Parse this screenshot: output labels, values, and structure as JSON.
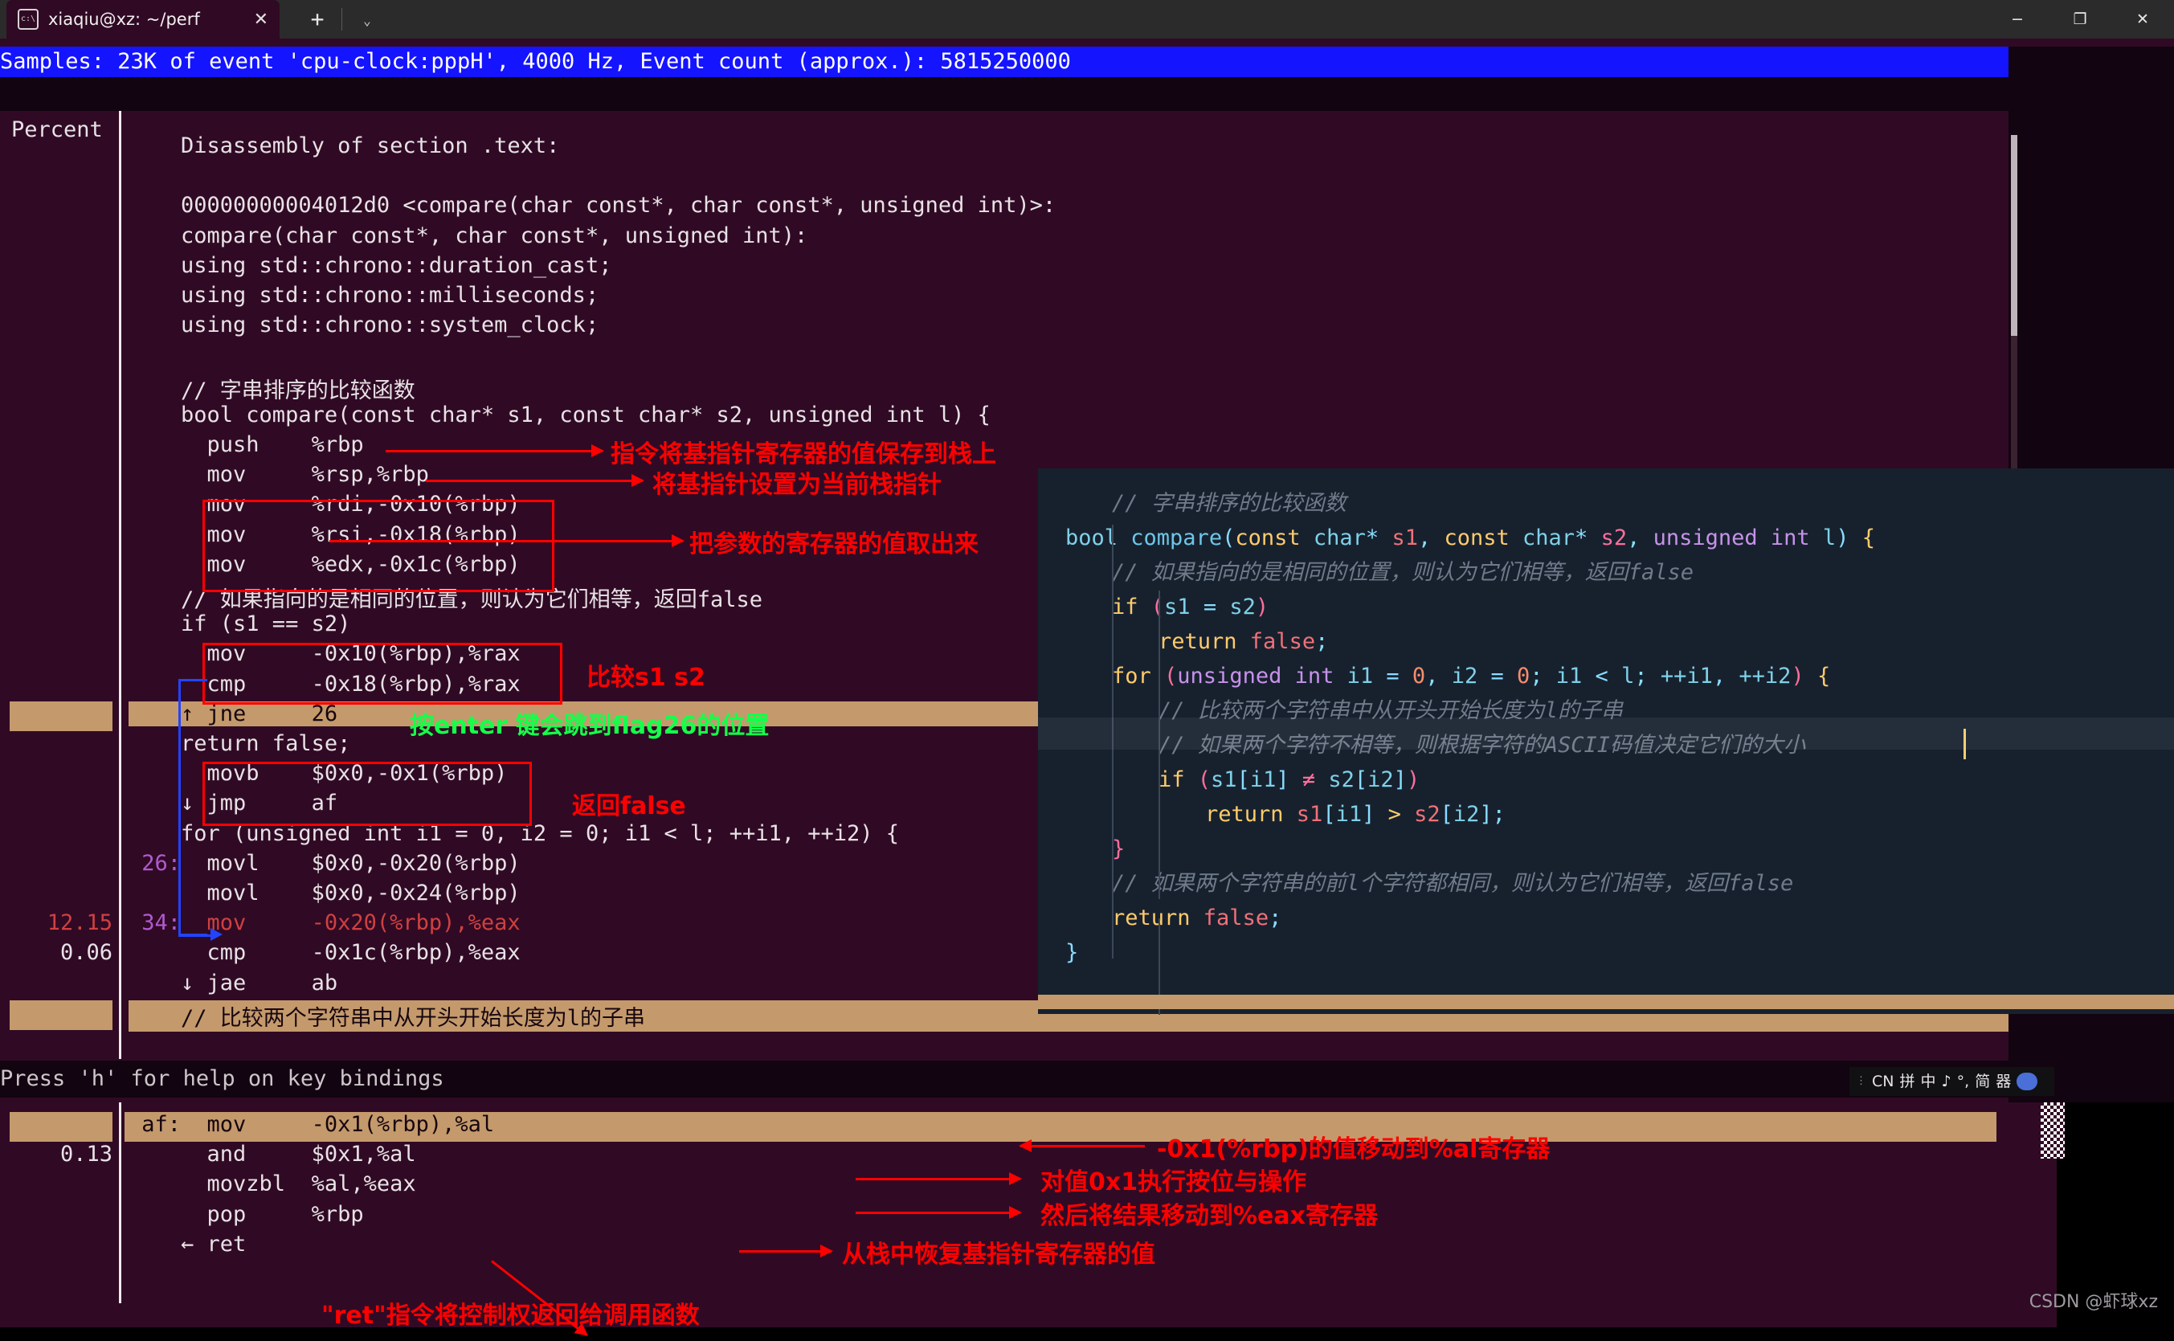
{
  "window": {
    "tab_title": "xiaqiu@xz: ~/perf",
    "terminal_icon": "terminal-icon",
    "close_tab": "✕",
    "new_tab": "+",
    "tab_menu": "⌄",
    "minimize": "−",
    "maximize": "❐",
    "close": "✕"
  },
  "perf": {
    "status_line": "Samples: 23K of event 'cpu-clock:pppH', 4000 Hz, Event count (approx.): 5815250000",
    "percent_header": "Percent",
    "help_line": "Press 'h' for help on key bindings",
    "lines": [
      {
        "pct": "",
        "text": "    Disassembly of section .text:"
      },
      {
        "pct": "",
        "text": ""
      },
      {
        "pct": "",
        "text": "    00000000004012d0 <compare(char const*, char const*, unsigned int)>:"
      },
      {
        "pct": "",
        "text": "    compare(char const*, char const*, unsigned int):"
      },
      {
        "pct": "",
        "text": "    using std::chrono::duration_cast;"
      },
      {
        "pct": "",
        "text": "    using std::chrono::milliseconds;"
      },
      {
        "pct": "",
        "text": "    using std::chrono::system_clock;"
      },
      {
        "pct": "",
        "text": ""
      },
      {
        "pct": "",
        "text": "    // 字串排序的比较函数"
      },
      {
        "pct": "",
        "text": "    bool compare(const char* s1, const char* s2, unsigned int l) {"
      },
      {
        "pct": "",
        "text": "      push    %rbp"
      },
      {
        "pct": "",
        "text": "      mov     %rsp,%rbp"
      },
      {
        "pct": "",
        "text": "      mov     %rdi,-0x10(%rbp)"
      },
      {
        "pct": "",
        "text": "      mov     %rsi,-0x18(%rbp)"
      },
      {
        "pct": "",
        "text": "      mov     %edx,-0x1c(%rbp)"
      },
      {
        "pct": "",
        "text": "    // 如果指向的是相同的位置，则认为它们相等，返回false"
      },
      {
        "pct": "",
        "text": "    if (s1 == s2)"
      },
      {
        "pct": "",
        "text": "      mov     -0x10(%rbp),%rax"
      },
      {
        "pct": "",
        "text": "      cmp     -0x18(%rbp),%rax"
      },
      {
        "pct": "",
        "text": "    ↑ jne     26",
        "highlight": true
      },
      {
        "pct": "",
        "text": "    return false;"
      },
      {
        "pct": "",
        "text": "      movb    $0x0,-0x1(%rbp)"
      },
      {
        "pct": "",
        "text": "    ↓ jmp     af"
      },
      {
        "pct": "",
        "text": "    for (unsigned int i1 = 0, i2 = 0; i1 < l; ++i1, ++i2) {"
      },
      {
        "pct": "",
        "text": " 26:  movl    $0x0,-0x20(%rbp)"
      },
      {
        "pct": "",
        "text": "      movl    $0x0,-0x24(%rbp)"
      },
      {
        "pct": "12.15",
        "text": " 34:  mov     -0x20(%rbp),%eax"
      },
      {
        "pct": " 0.06",
        "text": "      cmp     -0x1c(%rbp),%eax"
      },
      {
        "pct": "",
        "text": "    ↓ jae     ab"
      },
      {
        "pct": "",
        "text": "    // 比较两个字符串中从开头开始长度为l的子串",
        "highlight": true
      }
    ],
    "bottom_lines": [
      {
        "pct": "",
        "text": " af:  mov     -0x1(%rbp),%al",
        "highlight": true
      },
      {
        "pct": "0.13",
        "text": "      and     $0x1,%al"
      },
      {
        "pct": "",
        "text": "      movzbl  %al,%eax"
      },
      {
        "pct": "",
        "text": "      pop     %rbp"
      },
      {
        "pct": "",
        "text": "    ← ret"
      }
    ]
  },
  "annotations": {
    "a1": "指令将基指针寄存器的值保存到栈上",
    "a2": "将基指针设置为当前栈指针",
    "a3": "把参数的寄存器的值取出来",
    "a4": "比较s1 s2",
    "a5": "按enter 键会跳到flag26的位置",
    "a6": "返回false",
    "b1": "-0x1(%rbp)的值移动到%al寄存器",
    "b2": "对值0x1执行按位与操作",
    "b3": "然后将结果移动到%eax寄存器",
    "b4": "从栈中恢复基指针寄存器的值",
    "b5": "\"ret\"指令将控制权返回给调用函数",
    "color_red": "#ff0000",
    "color_green": "#16ff4a",
    "color_blue": "#2244ff"
  },
  "code_overlay": {
    "lines": [
      {
        "indent": 1,
        "tokens": [
          {
            "t": "// 字串排序的比较函数",
            "c": "cmt"
          }
        ]
      },
      {
        "indent": 0,
        "tokens": [
          {
            "t": "bool ",
            "c": "typ"
          },
          {
            "t": "compare",
            "c": "fn"
          },
          {
            "t": "(",
            "c": "pun"
          },
          {
            "t": "const ",
            "c": "yel"
          },
          {
            "t": "char",
            "c": "typ"
          },
          {
            "t": "* ",
            "c": "pun"
          },
          {
            "t": "s1",
            "c": "red"
          },
          {
            "t": ", ",
            "c": "pun"
          },
          {
            "t": "const ",
            "c": "yel"
          },
          {
            "t": "char",
            "c": "typ"
          },
          {
            "t": "* ",
            "c": "pun"
          },
          {
            "t": "s2",
            "c": "pk"
          },
          {
            "t": ", ",
            "c": "pun"
          },
          {
            "t": "unsigned int ",
            "c": "kw2"
          },
          {
            "t": "l",
            "c": "typ"
          },
          {
            "t": ") ",
            "c": "pun"
          },
          {
            "t": "{",
            "c": "yel"
          }
        ]
      },
      {
        "indent": 1,
        "tokens": [
          {
            "t": "// 如果指向的是相同的位置，则认为它们相等，返回false",
            "c": "cmt"
          }
        ]
      },
      {
        "indent": 1,
        "tokens": [
          {
            "t": "if ",
            "c": "yel"
          },
          {
            "t": "(",
            "c": "pk"
          },
          {
            "t": "s1",
            "c": "typ"
          },
          {
            "t": " = ",
            "c": "pun"
          },
          {
            "t": "s2",
            "c": "typ"
          },
          {
            "t": ")",
            "c": "pk"
          }
        ]
      },
      {
        "indent": 2,
        "tokens": [
          {
            "t": "return ",
            "c": "yel"
          },
          {
            "t": "false",
            "c": "red"
          },
          {
            "t": ";",
            "c": "pun"
          }
        ]
      },
      {
        "indent": 1,
        "tokens": [
          {
            "t": "for ",
            "c": "yel"
          },
          {
            "t": "(",
            "c": "pk"
          },
          {
            "t": "unsigned int ",
            "c": "kw2"
          },
          {
            "t": "i1",
            "c": "typ"
          },
          {
            "t": " = ",
            "c": "pun"
          },
          {
            "t": "0",
            "c": "num"
          },
          {
            "t": ", ",
            "c": "pun"
          },
          {
            "t": "i2",
            "c": "typ"
          },
          {
            "t": " = ",
            "c": "pun"
          },
          {
            "t": "0",
            "c": "num"
          },
          {
            "t": "; ",
            "c": "pun"
          },
          {
            "t": "i1",
            "c": "typ"
          },
          {
            "t": " < ",
            "c": "pun"
          },
          {
            "t": "l",
            "c": "typ"
          },
          {
            "t": "; ",
            "c": "pun"
          },
          {
            "t": "++i1",
            "c": "typ"
          },
          {
            "t": ", ",
            "c": "pun"
          },
          {
            "t": "++i2",
            "c": "typ"
          },
          {
            "t": ") ",
            "c": "pk"
          },
          {
            "t": "{",
            "c": "yel"
          }
        ]
      },
      {
        "indent": 2,
        "tokens": [
          {
            "t": "// 比较两个字符串中从开头开始长度为l的子串",
            "c": "cmt"
          }
        ]
      },
      {
        "indent": 2,
        "tokens": [
          {
            "t": "// 如果两个字符不相等，则根据字符的ASCII码值决定它们的大小",
            "c": "cmt"
          }
        ],
        "active": true
      },
      {
        "indent": 2,
        "tokens": [
          {
            "t": "if ",
            "c": "yel"
          },
          {
            "t": "(",
            "c": "pk"
          },
          {
            "t": "s1",
            "c": "typ"
          },
          {
            "t": "[",
            "c": "pun"
          },
          {
            "t": "i1",
            "c": "typ"
          },
          {
            "t": "] ",
            "c": "pun"
          },
          {
            "t": "≠ ",
            "c": "pk"
          },
          {
            "t": "s2",
            "c": "typ"
          },
          {
            "t": "[",
            "c": "pun"
          },
          {
            "t": "i2",
            "c": "typ"
          },
          {
            "t": "]",
            "c": "pun"
          },
          {
            "t": ")",
            "c": "pk"
          }
        ]
      },
      {
        "indent": 3,
        "tokens": [
          {
            "t": "return ",
            "c": "yel"
          },
          {
            "t": "s1",
            "c": "red"
          },
          {
            "t": "[",
            "c": "pun"
          },
          {
            "t": "i1",
            "c": "typ"
          },
          {
            "t": "] ",
            "c": "pun"
          },
          {
            "t": "> ",
            "c": "yel"
          },
          {
            "t": "s2",
            "c": "red"
          },
          {
            "t": "[",
            "c": "pun"
          },
          {
            "t": "i2",
            "c": "typ"
          },
          {
            "t": "];",
            "c": "pun"
          }
        ]
      },
      {
        "indent": 1,
        "tokens": [
          {
            "t": "}",
            "c": "pk"
          }
        ]
      },
      {
        "indent": 1,
        "tokens": [
          {
            "t": "// 如果两个字符串的前l个字符都相同，则认为它们相等，返回false",
            "c": "cmt"
          }
        ]
      },
      {
        "indent": 1,
        "tokens": [
          {
            "t": "return ",
            "c": "yel"
          },
          {
            "t": "false",
            "c": "red"
          },
          {
            "t": ";",
            "c": "pun"
          }
        ]
      },
      {
        "indent": 0,
        "tokens": [
          {
            "t": "}",
            "c": "pun"
          }
        ]
      }
    ]
  },
  "ime_tray": {
    "glyphs": [
      "CN",
      "拼",
      "中",
      "♪",
      "°,",
      "简",
      "器"
    ],
    "handle": "drag-handle"
  },
  "watermark": "CSDN @虾球xz"
}
